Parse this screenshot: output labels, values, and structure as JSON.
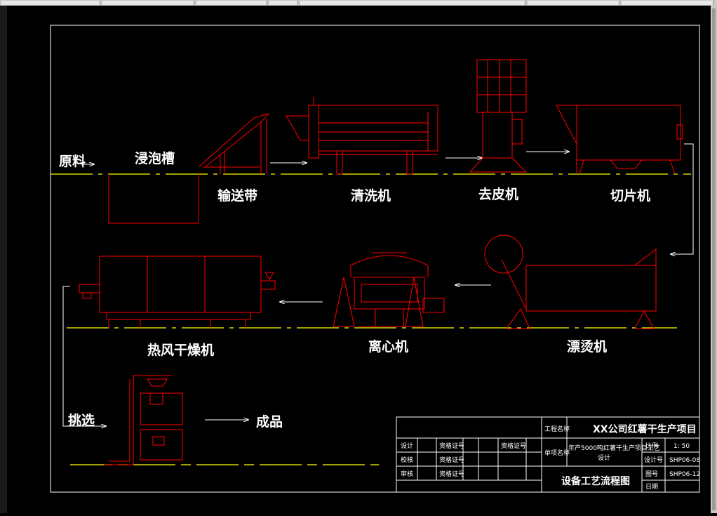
{
  "labels": {
    "raw_material": "原料",
    "soak_tank": "浸泡槽",
    "conveyor": "输送带",
    "washer": "清洗机",
    "peeler": "去皮机",
    "slicer": "切片机",
    "blancher": "漂烫机",
    "centrifuge": "离心机",
    "hot_air_dryer": "热风干燥机",
    "sorting": "挑选",
    "product": "成品"
  },
  "title_block": {
    "project_label": "工程名称",
    "project_name": "XX公司红薯干生产项目",
    "item_label": "单项名称",
    "item_name_line1": "年产5000吨红薯干生产项目工艺",
    "item_name_line2": "设计",
    "drawing_title": "设备工艺流程图",
    "scale_label": "比例",
    "scale_value": "1: 50",
    "design_no_label": "设计号",
    "design_no_value": "SHP06-08",
    "drawing_no_label": "图号",
    "drawing_no_value": "SHP06-12",
    "date_label": "日期",
    "rows": [
      {
        "role": "设计",
        "cert": "资格证号"
      },
      {
        "role": "校核",
        "cert": "资格证号"
      },
      {
        "role": "审核",
        "cert": "资格证号"
      }
    ],
    "cert_col2": "资格证号"
  },
  "colors": {
    "equipment": "#ff0000",
    "flow_arrow": "#ffffff",
    "ground_line": "#ffff00",
    "border": "#ffffff",
    "background": "#000000"
  }
}
